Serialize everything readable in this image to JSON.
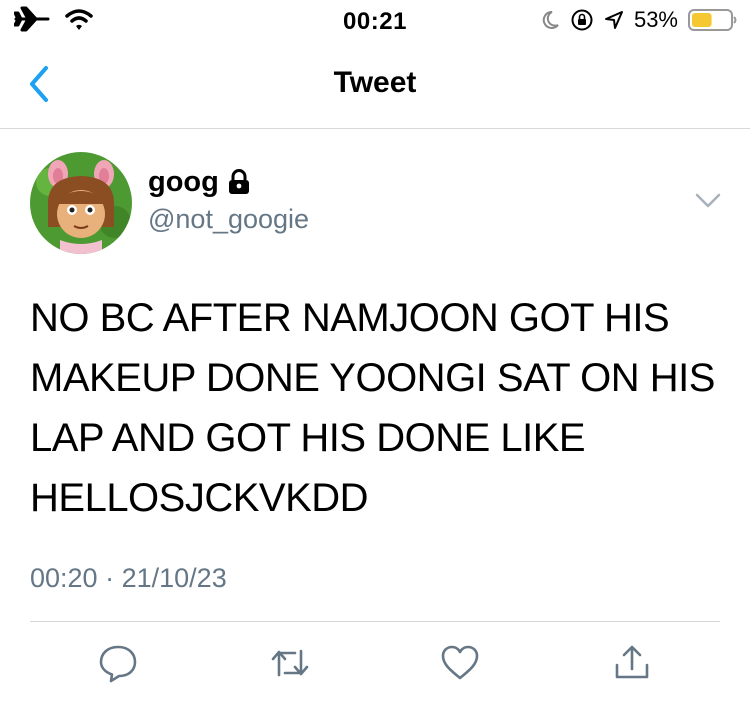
{
  "status_bar": {
    "time": "00:21",
    "battery_percent": "53%",
    "battery_level": 0.53,
    "icons": [
      "airplane-mode-icon",
      "wifi-icon",
      "moon-icon",
      "orientation-lock-icon",
      "location-arrow-icon",
      "battery-icon"
    ]
  },
  "header": {
    "title": "Tweet",
    "back_icon": "chevron-left-icon"
  },
  "tweet": {
    "author": {
      "display_name": "goog",
      "handle": "@not_googie",
      "protected_icon": "lock-icon",
      "avatar": "avatar-cartoon-character"
    },
    "text": "NO BC AFTER NAMJOON GOT HIS MAKEUP DONE YOONGI SAT ON HIS LAP AND GOT HIS DONE LIKE HELLOSJCKVKDD",
    "time": "00:20",
    "separator": "·",
    "date": "21/10/23"
  },
  "actions": [
    "reply-icon",
    "retweet-icon",
    "like-icon",
    "share-icon"
  ],
  "colors": {
    "accent": "#1da1f2",
    "secondary_text": "#657786",
    "divider": "#d6d9dc",
    "battery_fill": "#f5c730"
  }
}
